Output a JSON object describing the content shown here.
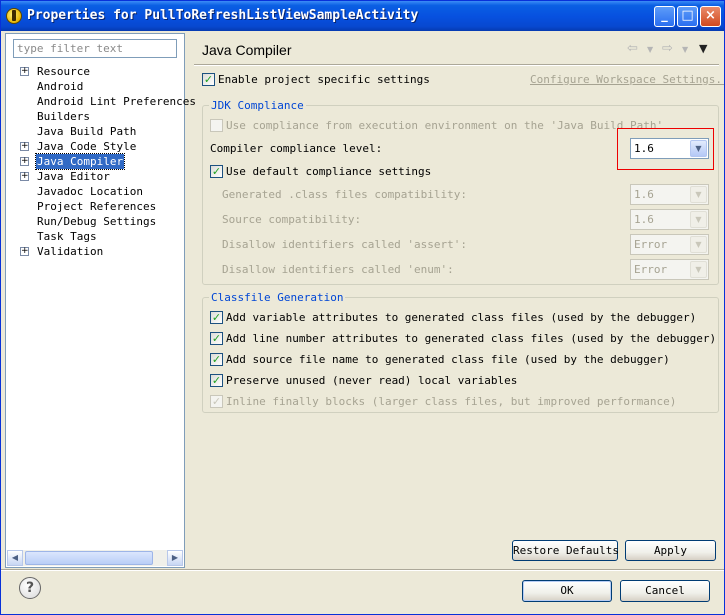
{
  "window": {
    "title": "Properties for PullToRefreshListViewSampleActivity",
    "buttons": {
      "minimize": "_",
      "maximize": "□",
      "close": "×"
    }
  },
  "sidebar": {
    "filter_placeholder": "type filter text",
    "items": [
      {
        "label": "Resource",
        "expandable": true
      },
      {
        "label": "Android",
        "expandable": false
      },
      {
        "label": "Android Lint Preferences",
        "expandable": false
      },
      {
        "label": "Builders",
        "expandable": false
      },
      {
        "label": "Java Build Path",
        "expandable": false
      },
      {
        "label": "Java Code Style",
        "expandable": true
      },
      {
        "label": "Java Compiler",
        "expandable": true,
        "selected": true
      },
      {
        "label": "Java Editor",
        "expandable": true
      },
      {
        "label": "Javadoc Location",
        "expandable": false
      },
      {
        "label": "Project References",
        "expandable": false
      },
      {
        "label": "Run/Debug Settings",
        "expandable": false
      },
      {
        "label": "Task Tags",
        "expandable": false
      },
      {
        "label": "Validation",
        "expandable": true
      }
    ]
  },
  "page": {
    "title": "Java Compiler",
    "icons": {
      "back": "back-arrow-icon",
      "forward": "forward-arrow-icon",
      "menu": "view-menu-icon"
    },
    "enable_project_specific": {
      "label": "Enable project specific settings",
      "checked": true
    },
    "configure_link": "Configure Workspace Settings...",
    "jdk": {
      "group_title": "JDK Compliance",
      "use_execution_env": {
        "label": "Use compliance from execution environment on the 'Java Build Path'",
        "checked": false,
        "enabled": false
      },
      "compliance_level_label": "Compiler compliance level:",
      "compliance_level_value": "1.6",
      "use_default": {
        "label": "Use default compliance settings",
        "checked": true
      },
      "generated_label": "Generated .class files compatibility:",
      "generated_value": "1.6",
      "source_label": "Source compatibility:",
      "source_value": "1.6",
      "assert_label": "Disallow identifiers called 'assert':",
      "assert_value": "Error",
      "enum_label": "Disallow identifiers called 'enum':",
      "enum_value": "Error"
    },
    "classfile": {
      "group_title": "Classfile Generation",
      "options": [
        {
          "label": "Add variable attributes to generated class files (used by the debugger)",
          "checked": true,
          "enabled": true
        },
        {
          "label": "Add line number attributes to generated class files (used by the debugger)",
          "checked": true,
          "enabled": true
        },
        {
          "label": "Add source file name to generated class file (used by the debugger)",
          "checked": true,
          "enabled": true
        },
        {
          "label": "Preserve unused (never read) local variables",
          "checked": true,
          "enabled": true
        },
        {
          "label": "Inline finally blocks (larger class files, but improved performance)",
          "checked": true,
          "enabled": false
        }
      ]
    },
    "restore_defaults": "Restore Defaults",
    "apply": "Apply"
  },
  "footer": {
    "help_icon": "?",
    "ok": "OK",
    "cancel": "Cancel"
  }
}
